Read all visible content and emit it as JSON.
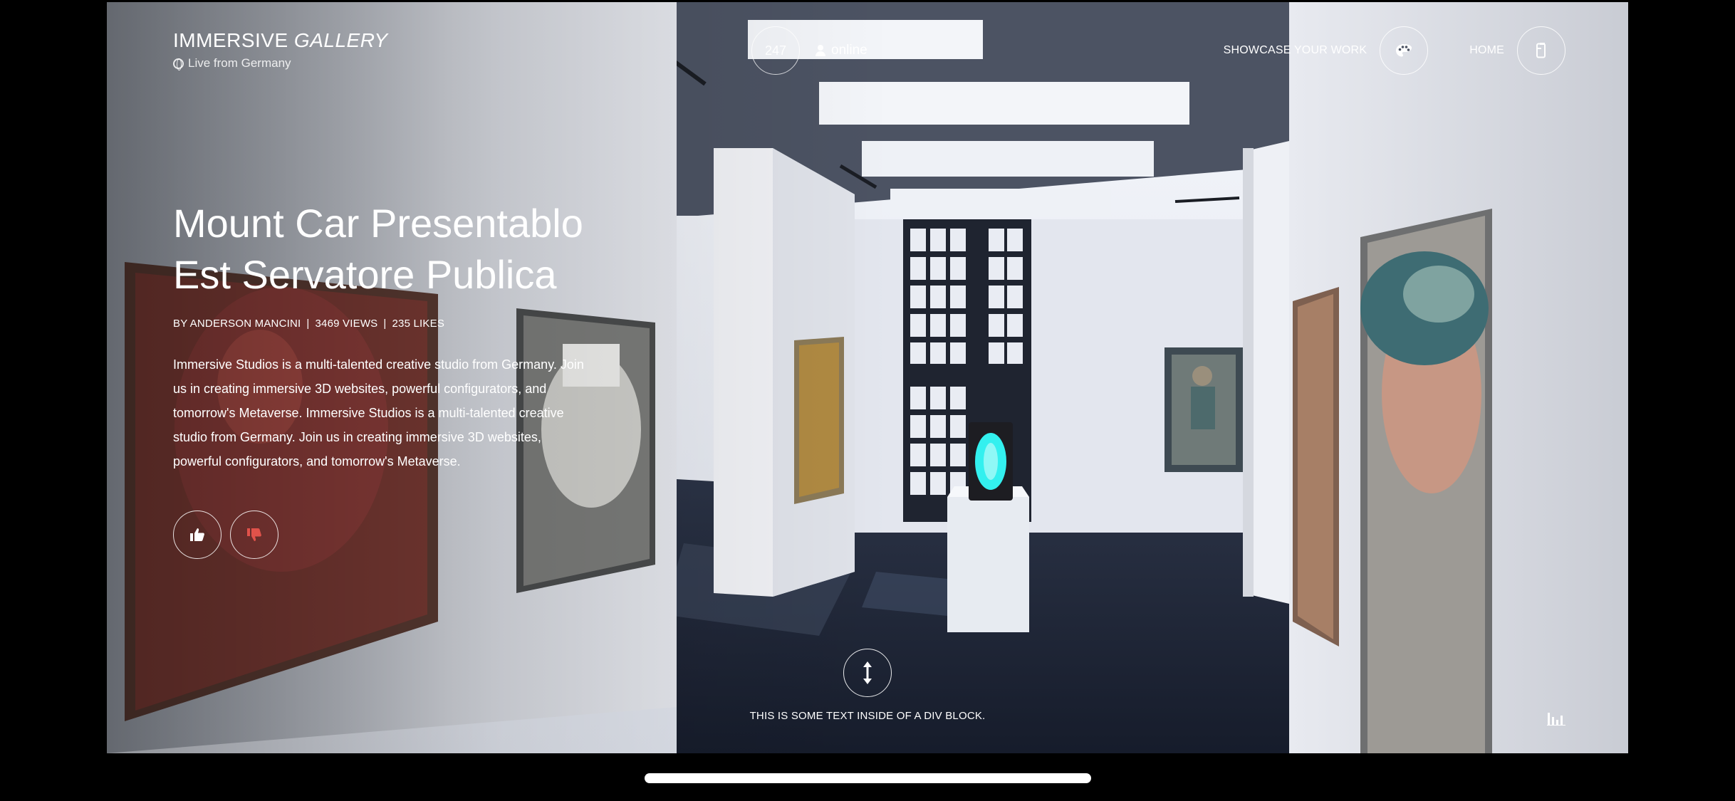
{
  "brand": {
    "title_plain": "IMMERSIVE",
    "title_italic": "GALLERY",
    "subtitle": "Live from Germany"
  },
  "counter": {
    "value": "247",
    "label": "online"
  },
  "nav": {
    "showcase_label": "SHOWCASE YOUR WORK",
    "home_label": "HOME"
  },
  "artwork": {
    "title_line1": "Mount Car Presentablo",
    "title_line2": "Est Servatore Publica",
    "author": "BY ANDERSON MANCINI",
    "views": "3469 VIEWS",
    "likes": "235 LIKES",
    "separator": "|",
    "description": "Immersive Studios is a multi-talented creative studio from Germany. Join us in creating immersive 3D websites, powerful configurators, and tomorrow's Metaverse. Immersive Studios is a multi-talented creative studio from Germany. Join us in creating immersive 3D websites, powerful configurators, and tomorrow's Metaverse."
  },
  "scroll_hint": {
    "text": "THIS IS SOME TEXT INSIDE OF A DIV BLOCK."
  },
  "icons": {
    "globe": "globe-icon",
    "user": "user-icon",
    "palette": "palette-icon",
    "home": "phone-home-icon",
    "like": "thumbs-up-icon",
    "dislike": "thumbs-down-icon",
    "scroll": "vertical-arrows-icon",
    "audio": "equalizer-icon"
  },
  "colors": {
    "dislike": "#e0524a",
    "floor": "#1c2436",
    "wall": "#eceef3",
    "pedestal_glow": "#33f0ef"
  }
}
